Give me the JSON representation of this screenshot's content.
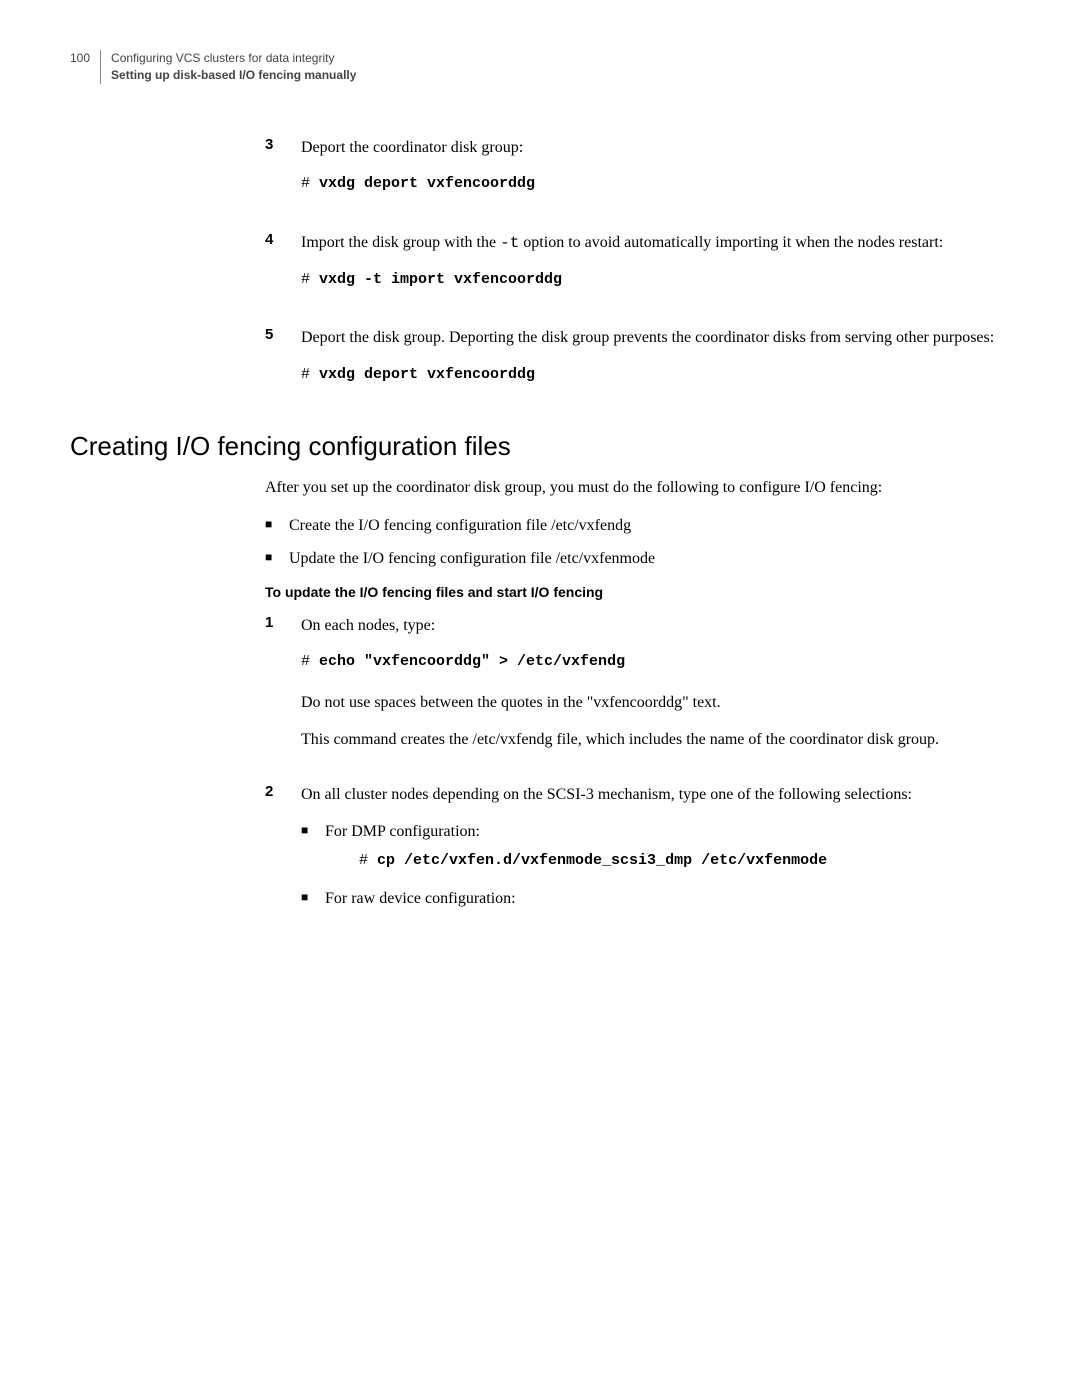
{
  "header": {
    "pagenum": "100",
    "line1": "Configuring VCS clusters for data integrity",
    "line2": "Setting up disk-based I/O fencing manually"
  },
  "steps_top": [
    {
      "num": "3",
      "para": "Deport the coordinator disk group:",
      "code_prefix": "# ",
      "code_bold": "vxdg deport vxfencoorddg"
    },
    {
      "num": "4",
      "para_pre": "Import the disk group with the ",
      "para_mono": "-t",
      "para_post": " option to avoid automatically importing it when the nodes restart:",
      "code_prefix": "# ",
      "code_bold": "vxdg -t import vxfencoorddg"
    },
    {
      "num": "5",
      "para": "Deport the disk group. Deporting the disk group prevents the coordinator disks from serving other purposes:",
      "code_prefix": "# ",
      "code_bold": "vxdg deport vxfencoorddg"
    }
  ],
  "h2": "Creating I/O fencing configuration files",
  "intro": "After you set up the coordinator disk group, you must do the following to configure I/O fencing:",
  "bullets": [
    "Create the I/O fencing configuration file /etc/vxfendg",
    "Update the I/O fencing configuration file /etc/vxfenmode"
  ],
  "subhead": "To update the I/O fencing files and start I/O fencing",
  "steps_bottom": {
    "step1": {
      "num": "1",
      "para": "On each nodes, type:",
      "code_prefix": "# ",
      "code_bold": "echo \"vxfencoorddg\" > /etc/vxfendg",
      "after1": "Do not use spaces between the quotes in the \"vxfencoorddg\" text.",
      "after2": "This command creates the /etc/vxfendg file, which includes the name of the coordinator disk group."
    },
    "step2": {
      "num": "2",
      "para": "On all cluster nodes depending on the SCSI-3 mechanism, type one of the following selections:",
      "sub": [
        {
          "label": "For DMP configuration:",
          "code_prefix": "# ",
          "code_bold": "cp /etc/vxfen.d/vxfenmode_scsi3_dmp /etc/vxfenmode"
        },
        {
          "label": "For raw device configuration:"
        }
      ]
    }
  }
}
